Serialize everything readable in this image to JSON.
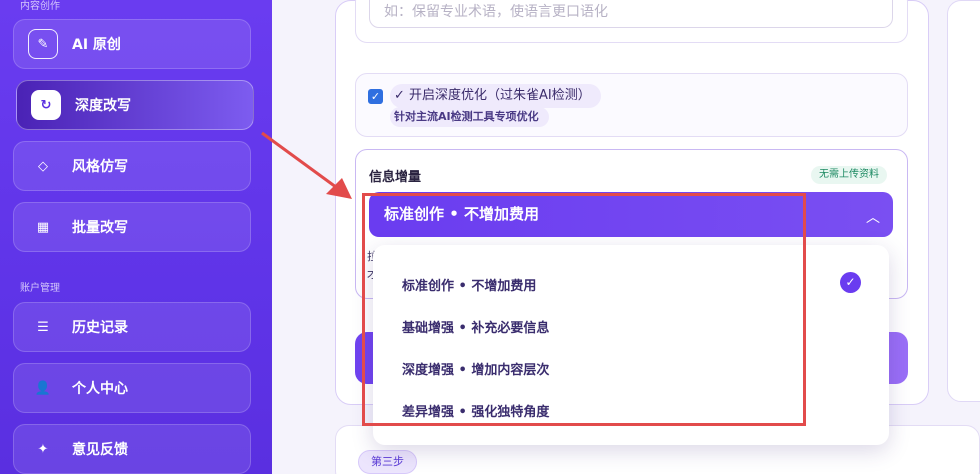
{
  "sidebar": {
    "section_content": "内容创作",
    "section_account": "账户管理",
    "items": [
      {
        "label": "AI 原创",
        "icon": "pen-icon"
      },
      {
        "label": "深度改写",
        "icon": "refresh-icon"
      },
      {
        "label": "风格仿写",
        "icon": "diamond-icon"
      },
      {
        "label": "批量改写",
        "icon": "grid-icon"
      },
      {
        "label": "历史记录",
        "icon": "list-icon"
      },
      {
        "label": "个人中心",
        "icon": "user-icon"
      },
      {
        "label": "意见反馈",
        "icon": "sparkle-icon"
      }
    ]
  },
  "form": {
    "requirement_placeholder": "如：保留专业术语，使语言更口语化",
    "deep_opt_label": "✓ 开启深度优化（过朱雀AI检测）",
    "deep_opt_sub": "针对主流AI检测工具专项优化",
    "info_title": "信息增量",
    "info_badge": "无需上传资料",
    "selected_value": "标准创作 • 不增加费用",
    "hidden_line_1": "拉",
    "hidden_line_2": "才",
    "step_badge": "第三步"
  },
  "dropdown": {
    "options": [
      "标准创作 • 不增加费用",
      "基础增强 • 补充必要信息",
      "深度增强 • 增加内容层次",
      "差异增强 • 强化独特角度"
    ],
    "selected_index": 0
  },
  "colors": {
    "accent": "#6a3cf0",
    "annotation": "#e24b4b"
  }
}
